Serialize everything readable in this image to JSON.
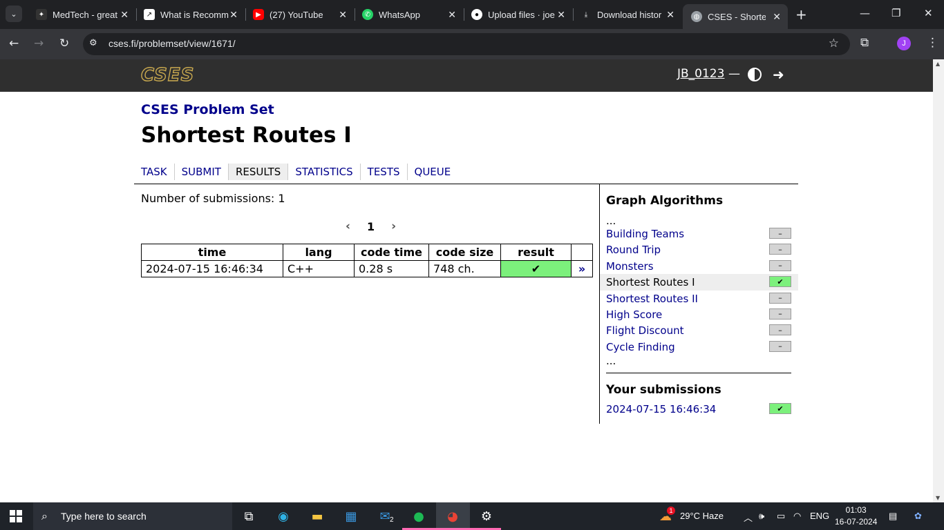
{
  "browser": {
    "tabs": [
      {
        "label": "MedTech - great",
        "icon": "medtech-icon"
      },
      {
        "label": "What is Recomm",
        "icon": "chart-icon"
      },
      {
        "label": "(27) YouTube",
        "icon": "youtube-icon"
      },
      {
        "label": "WhatsApp",
        "icon": "whatsapp-icon"
      },
      {
        "label": "Upload files · joe",
        "icon": "github-icon"
      },
      {
        "label": "Download histor",
        "icon": "download-icon"
      },
      {
        "label": "CSES - Shortest R",
        "icon": "globe-icon"
      }
    ],
    "url": "cses.fi/problemset/view/1671/",
    "profile_initial": "J"
  },
  "site": {
    "logo": "CSES",
    "user": "JB_0123",
    "dash": "—"
  },
  "main": {
    "problemset_title": "CSES Problem Set",
    "page_title": "Shortest Routes I",
    "nav": [
      "TASK",
      "SUBMIT",
      "RESULTS",
      "STATISTICS",
      "TESTS",
      "QUEUE"
    ],
    "active_nav": "RESULTS",
    "num_submissions_label": "Number of submissions: 1",
    "pager": {
      "prev": "‹",
      "page": "1",
      "next": "›"
    },
    "table": {
      "headers": [
        "time",
        "lang",
        "code time",
        "code size",
        "result",
        ""
      ],
      "rows": [
        {
          "time": "2024-07-15 16:46:34",
          "lang": "C++",
          "code_time": "0.28 s",
          "code_size": "748 ch.",
          "result": "✔",
          "more": "»"
        }
      ]
    }
  },
  "sidebar": {
    "section_title": "Graph Algorithms",
    "ellipsis": "...",
    "items": [
      {
        "label": "Building Teams",
        "status": "–"
      },
      {
        "label": "Round Trip",
        "status": "–"
      },
      {
        "label": "Monsters",
        "status": "–"
      },
      {
        "label": "Shortest Routes I",
        "status": "✔"
      },
      {
        "label": "Shortest Routes II",
        "status": "–"
      },
      {
        "label": "High Score",
        "status": "–"
      },
      {
        "label": "Flight Discount",
        "status": "–"
      },
      {
        "label": "Cycle Finding",
        "status": "–"
      }
    ],
    "your_submissions_title": "Your submissions",
    "submissions": [
      {
        "time": "2024-07-15 16:46:34",
        "status": "✔"
      }
    ]
  },
  "taskbar": {
    "search_placeholder": "Type here to search",
    "weather": "29°C  Haze",
    "lang": "ENG",
    "time": "01:03",
    "date": "16-07-2024",
    "mail_badge": "2",
    "weather_badge": "1"
  },
  "colors": {
    "cses_navy": "#00008b",
    "accept_green": "#7cf07c",
    "header_dark": "#2f2f2f"
  }
}
